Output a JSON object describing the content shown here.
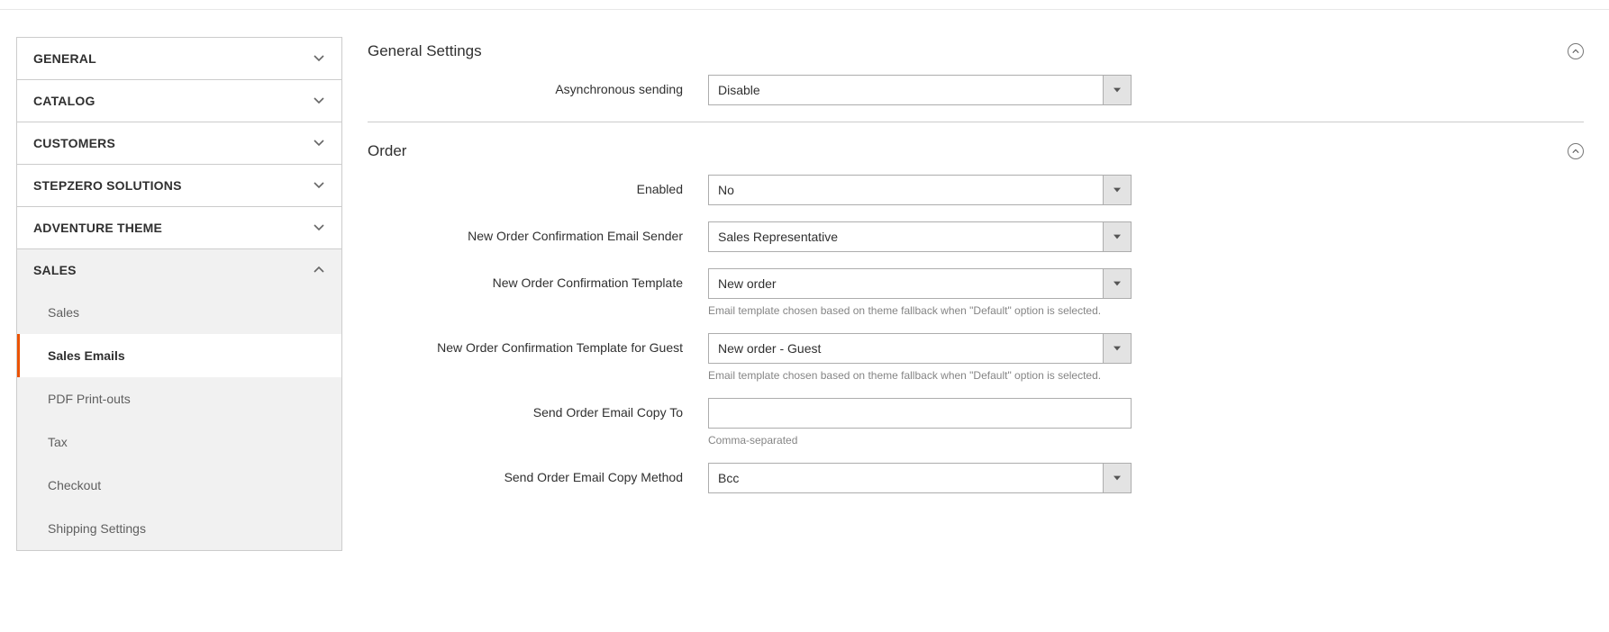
{
  "sidebar": {
    "sections": [
      {
        "label": "GENERAL",
        "expanded": false
      },
      {
        "label": "CATALOG",
        "expanded": false
      },
      {
        "label": "CUSTOMERS",
        "expanded": false
      },
      {
        "label": "STEPZERO SOLUTIONS",
        "expanded": false
      },
      {
        "label": "ADVENTURE THEME",
        "expanded": false
      },
      {
        "label": "SALES",
        "expanded": true,
        "items": [
          {
            "label": "Sales",
            "active": false
          },
          {
            "label": "Sales Emails",
            "active": true
          },
          {
            "label": "PDF Print-outs",
            "active": false
          },
          {
            "label": "Tax",
            "active": false
          },
          {
            "label": "Checkout",
            "active": false
          },
          {
            "label": "Shipping Settings",
            "active": false
          }
        ]
      }
    ]
  },
  "main": {
    "general_settings": {
      "title": "General Settings",
      "async_sending": {
        "label": "Asynchronous sending",
        "value": "Disable"
      }
    },
    "order": {
      "title": "Order",
      "enabled": {
        "label": "Enabled",
        "value": "No"
      },
      "sender": {
        "label": "New Order Confirmation Email Sender",
        "value": "Sales Representative"
      },
      "template": {
        "label": "New Order Confirmation Template",
        "value": "New order",
        "hint": "Email template chosen based on theme fallback when \"Default\" option is selected."
      },
      "template_guest": {
        "label": "New Order Confirmation Template for Guest",
        "value": "New order - Guest",
        "hint": "Email template chosen based on theme fallback when \"Default\" option is selected."
      },
      "copy_to": {
        "label": "Send Order Email Copy To",
        "value": "",
        "hint": "Comma-separated"
      },
      "copy_method": {
        "label": "Send Order Email Copy Method",
        "value": "Bcc"
      }
    }
  }
}
